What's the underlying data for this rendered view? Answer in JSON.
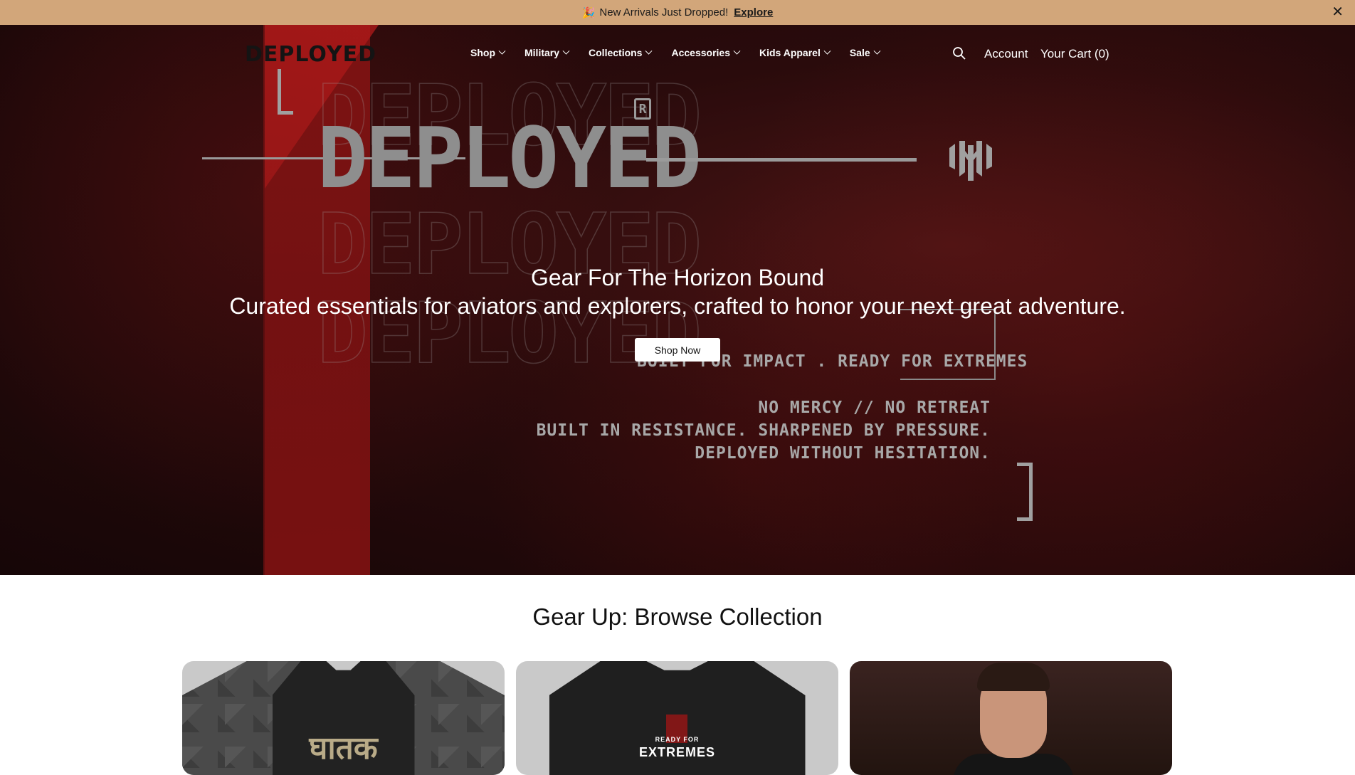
{
  "announcement": {
    "icon": "🎉",
    "text": "New Arrivals Just Dropped!",
    "link": "Explore",
    "close": "✕"
  },
  "header": {
    "logo": "DEPLOYED",
    "menu": [
      "Shop",
      "Military",
      "Collections",
      "Accessories",
      "Kids Apparel",
      "Sale"
    ],
    "account": "Account",
    "cart": "Your Cart (0)"
  },
  "hero": {
    "brand": "DEPLOYED",
    "reg_mark": "R",
    "title": "Gear For The Horizon Bound",
    "subtitle": "Curated essentials for aviators and explorers, crafted to honor your next great adventure.",
    "button": "Shop Now",
    "tagline_1": "BUILT FOR IMPACT . READY FOR EXTREMES",
    "tagline_2": "NO MERCY // NO RETREAT",
    "tagline_3": "BUILT IN RESISTANCE. SHARPENED BY PRESSURE.",
    "tagline_4": "DEPLOYED WITHOUT HESITATION."
  },
  "collection": {
    "title": "Gear Up: Browse Collection",
    "cards": [
      {
        "print": "घातक"
      },
      {
        "print_top": "READY FOR",
        "print_main": "EXTREMES"
      },
      {
        "print": ""
      }
    ]
  },
  "colors": {
    "announcement_bg": "#d2a67a",
    "hero_red": "#8c1414",
    "hero_dark": "#160607"
  }
}
